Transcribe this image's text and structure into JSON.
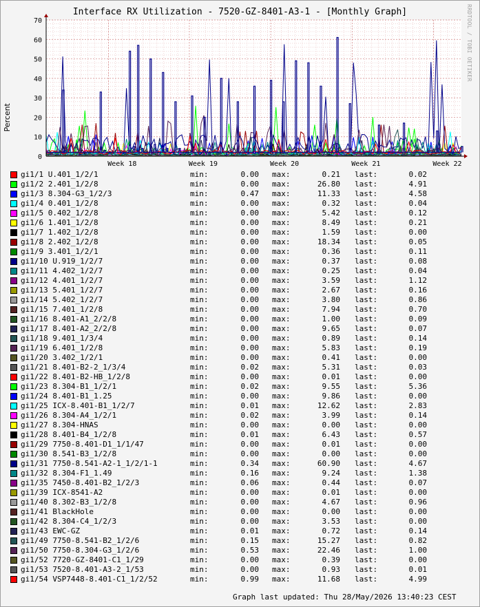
{
  "chart_data": {
    "type": "line",
    "title": "Interface RX Utilization - 7520-GZ-8401-A3-1 - [Monthly Graph]",
    "ylabel": "Percent",
    "ylim": [
      0,
      70
    ],
    "y_ticks": [
      "0",
      "10",
      "20",
      "30",
      "40",
      "50",
      "60",
      "70"
    ],
    "x_ticks": [
      "Week 18",
      "Week 19",
      "Week 20",
      "Week 21",
      "Week 22"
    ],
    "grid": true,
    "legend_placement": "bottom",
    "stat_labels": {
      "min": "min:",
      "max": "max:",
      "last": "last:"
    },
    "series": [
      {
        "name": "gi1/1 U.401_1/2/1",
        "color": "#ff0000",
        "min": "0.00",
        "max": "0.21",
        "last": "0.02"
      },
      {
        "name": "gi1/2 2.401_1/2/8",
        "color": "#00ff00",
        "min": "0.00",
        "max": "26.80",
        "last": "4.91"
      },
      {
        "name": "gi1/3 8.304-G3_1/2/3",
        "color": "#0000ff",
        "min": "0.47",
        "max": "11.33",
        "last": "4.58"
      },
      {
        "name": "gi1/4 0.401_1/2/8",
        "color": "#00ffff",
        "min": "0.00",
        "max": "0.32",
        "last": "0.04"
      },
      {
        "name": "gi1/5 0.402_1/2/8",
        "color": "#ff00ff",
        "min": "0.00",
        "max": "5.42",
        "last": "0.12"
      },
      {
        "name": "gi1/6 1.401_1/2/8",
        "color": "#ffff00",
        "min": "0.00",
        "max": "8.49",
        "last": "0.21"
      },
      {
        "name": "gi1/7 1.402_1/2/8",
        "color": "#000000",
        "min": "0.00",
        "max": "1.59",
        "last": "0.00"
      },
      {
        "name": "gi1/8 2.402_1/2/8",
        "color": "#990000",
        "min": "0.00",
        "max": "18.34",
        "last": "0.05"
      },
      {
        "name": "gi1/9 3.401_1/2/1",
        "color": "#008800",
        "min": "0.00",
        "max": "0.36",
        "last": "0.11"
      },
      {
        "name": "gi1/10 U.919_1/2/7",
        "color": "#000088",
        "min": "0.00",
        "max": "0.37",
        "last": "0.08"
      },
      {
        "name": "gi1/11 4.402_1/2/7",
        "color": "#008888",
        "min": "0.00",
        "max": "0.25",
        "last": "0.04"
      },
      {
        "name": "gi1/12 4.401_1/2/7",
        "color": "#880088",
        "min": "0.00",
        "max": "3.59",
        "last": "1.12"
      },
      {
        "name": "gi1/13 5.401_1/2/7",
        "color": "#999900",
        "min": "0.00",
        "max": "2.67",
        "last": "0.16"
      },
      {
        "name": "gi1/14 5.402_1/2/7",
        "color": "#999999",
        "min": "0.00",
        "max": "3.80",
        "last": "0.86"
      },
      {
        "name": "gi1/15 7.401_1/2/8",
        "color": "#552222",
        "min": "0.00",
        "max": "7.94",
        "last": "0.70"
      },
      {
        "name": "gi1/16 8.401-A1_2/2/8",
        "color": "#225522",
        "min": "0.00",
        "max": "1.00",
        "last": "0.09"
      },
      {
        "name": "gi1/17 8.401-A2_2/2/8",
        "color": "#222255",
        "min": "0.00",
        "max": "9.65",
        "last": "0.07"
      },
      {
        "name": "gi1/18 9.401_1/3/4",
        "color": "#225555",
        "min": "0.00",
        "max": "0.89",
        "last": "0.14"
      },
      {
        "name": "gi1/19 6.401_1/2/8",
        "color": "#552255",
        "min": "0.00",
        "max": "5.83",
        "last": "0.19"
      },
      {
        "name": "gi1/20 3.402_1/2/1",
        "color": "#555522",
        "min": "0.00",
        "max": "0.41",
        "last": "0.00"
      },
      {
        "name": "gi1/21 8.401-B2-2_1/3/4",
        "color": "#555555",
        "min": "0.02",
        "max": "5.31",
        "last": "0.03"
      },
      {
        "name": "gi1/22 8.401-B2-HB_1/2/8",
        "color": "#ff0000",
        "min": "0.00",
        "max": "0.01",
        "last": "0.00"
      },
      {
        "name": "gi1/23 8.304-B1_1/2/1",
        "color": "#00ff00",
        "min": "0.02",
        "max": "9.55",
        "last": "5.36"
      },
      {
        "name": "gi1/24 8.401-B1_1.25",
        "color": "#0000ff",
        "min": "0.00",
        "max": "9.86",
        "last": "0.00"
      },
      {
        "name": "gi1/25 ICX-8.401-B1_1/2/7",
        "color": "#00ffff",
        "min": "0.01",
        "max": "12.62",
        "last": "2.83"
      },
      {
        "name": "gi1/26 8.304-A4_1/2/1",
        "color": "#ff00ff",
        "min": "0.02",
        "max": "3.99",
        "last": "0.14"
      },
      {
        "name": "gi1/27 8.304-HNAS",
        "color": "#ffff00",
        "min": "0.00",
        "max": "0.00",
        "last": "0.00"
      },
      {
        "name": "gi1/28 8.401-B4_1/2/8",
        "color": "#000000",
        "min": "0.01",
        "max": "6.43",
        "last": "0.57"
      },
      {
        "name": "gi1/29 7750-8.401-D1_1/1/47",
        "color": "#990000",
        "min": "0.00",
        "max": "0.01",
        "last": "0.00"
      },
      {
        "name": "gi1/30 8.541-B3_1/2/8",
        "color": "#008800",
        "min": "0.00",
        "max": "0.00",
        "last": "0.00"
      },
      {
        "name": "gi1/31 7750-8.541-A2-1_1/2/1-1",
        "color": "#000088",
        "min": "0.34",
        "max": "60.90",
        "last": "4.67"
      },
      {
        "name": "gi1/32 8.304-F1_1.49",
        "color": "#008888",
        "min": "0.16",
        "max": "9.24",
        "last": "1.38"
      },
      {
        "name": "gi1/35 7450-8.401-B2_1/2/3",
        "color": "#880088",
        "min": "0.06",
        "max": "0.44",
        "last": "0.07"
      },
      {
        "name": "gi1/39 ICX-8541-A2",
        "color": "#999900",
        "min": "0.00",
        "max": "0.01",
        "last": "0.00"
      },
      {
        "name": "gi1/40 8.302-B3_1/2/8",
        "color": "#999999",
        "min": "0.00",
        "max": "4.67",
        "last": "0.96"
      },
      {
        "name": "gi1/41 BlackHole",
        "color": "#552222",
        "min": "0.00",
        "max": "0.00",
        "last": "0.00"
      },
      {
        "name": "gi1/42 8.304-C4_1/2/3",
        "color": "#225522",
        "min": "0.00",
        "max": "3.53",
        "last": "0.00"
      },
      {
        "name": "gi1/43 EWC-GZ",
        "color": "#222255",
        "min": "0.01",
        "max": "0.72",
        "last": "0.14"
      },
      {
        "name": "gi1/49 7750-8.541-B2_1/2/6",
        "color": "#225555",
        "min": "0.15",
        "max": "15.27",
        "last": "0.82"
      },
      {
        "name": "gi1/50 7750-8.304-G3_1/2/6",
        "color": "#552255",
        "min": "0.53",
        "max": "22.46",
        "last": "1.00"
      },
      {
        "name": "gi1/52 7720-GZ-8401-C1_1/29",
        "color": "#555522",
        "min": "0.00",
        "max": "0.39",
        "last": "0.00"
      },
      {
        "name": "gi1/53 7520-8.401-A3-2_1/53",
        "color": "#555555",
        "min": "0.00",
        "max": "0.93",
        "last": "0.01"
      },
      {
        "name": "gi1/54 VSP7448-8.401-C1_1/2/52",
        "color": "#ff0000",
        "min": "0.99",
        "max": "11.68",
        "last": "4.99"
      }
    ],
    "highlight_spikes": [
      {
        "series": "gi1/31 7750-8.541-A2-1_1/2/1-1",
        "points": [
          [
            0.04,
            34
          ],
          [
            0.045,
            3
          ],
          [
            0.13,
            33
          ],
          [
            0.14,
            3
          ],
          [
            0.2,
            54
          ],
          [
            0.21,
            5
          ],
          [
            0.22,
            57
          ],
          [
            0.23,
            4
          ],
          [
            0.25,
            50
          ],
          [
            0.26,
            6
          ],
          [
            0.28,
            43
          ],
          [
            0.29,
            4
          ],
          [
            0.31,
            28
          ],
          [
            0.32,
            4
          ],
          [
            0.35,
            31
          ],
          [
            0.38,
            20
          ],
          [
            0.42,
            40
          ],
          [
            0.46,
            28
          ],
          [
            0.5,
            36
          ],
          [
            0.54,
            39
          ],
          [
            0.57,
            28
          ],
          [
            0.6,
            49
          ],
          [
            0.63,
            48
          ],
          [
            0.66,
            36
          ],
          [
            0.7,
            61
          ],
          [
            0.73,
            27
          ],
          [
            0.8,
            16
          ],
          [
            0.86,
            17
          ],
          [
            0.94,
            13
          ],
          [
            1.0,
            5
          ]
        ]
      }
    ]
  },
  "watermark": "RRDTOOL / TOBI OETIKER",
  "footer": "Graph last updated: Thu 28/May/2026 13:40:23 CEST"
}
